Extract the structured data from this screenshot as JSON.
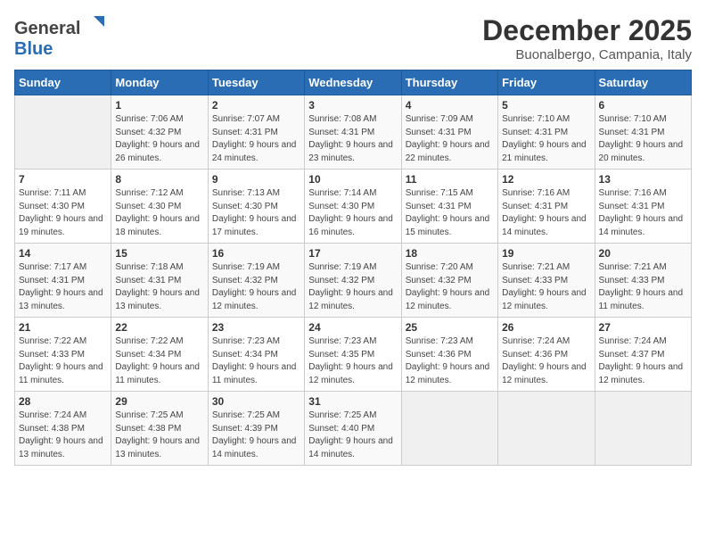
{
  "header": {
    "logo_general": "General",
    "logo_blue": "Blue",
    "month_title": "December 2025",
    "location": "Buonalbergo, Campania, Italy"
  },
  "days_of_week": [
    "Sunday",
    "Monday",
    "Tuesday",
    "Wednesday",
    "Thursday",
    "Friday",
    "Saturday"
  ],
  "weeks": [
    [
      {
        "day": "",
        "sunrise": "",
        "sunset": "",
        "daylight": ""
      },
      {
        "day": "1",
        "sunrise": "Sunrise: 7:06 AM",
        "sunset": "Sunset: 4:32 PM",
        "daylight": "Daylight: 9 hours and 26 minutes."
      },
      {
        "day": "2",
        "sunrise": "Sunrise: 7:07 AM",
        "sunset": "Sunset: 4:31 PM",
        "daylight": "Daylight: 9 hours and 24 minutes."
      },
      {
        "day": "3",
        "sunrise": "Sunrise: 7:08 AM",
        "sunset": "Sunset: 4:31 PM",
        "daylight": "Daylight: 9 hours and 23 minutes."
      },
      {
        "day": "4",
        "sunrise": "Sunrise: 7:09 AM",
        "sunset": "Sunset: 4:31 PM",
        "daylight": "Daylight: 9 hours and 22 minutes."
      },
      {
        "day": "5",
        "sunrise": "Sunrise: 7:10 AM",
        "sunset": "Sunset: 4:31 PM",
        "daylight": "Daylight: 9 hours and 21 minutes."
      },
      {
        "day": "6",
        "sunrise": "Sunrise: 7:10 AM",
        "sunset": "Sunset: 4:31 PM",
        "daylight": "Daylight: 9 hours and 20 minutes."
      }
    ],
    [
      {
        "day": "7",
        "sunrise": "Sunrise: 7:11 AM",
        "sunset": "Sunset: 4:30 PM",
        "daylight": "Daylight: 9 hours and 19 minutes."
      },
      {
        "day": "8",
        "sunrise": "Sunrise: 7:12 AM",
        "sunset": "Sunset: 4:30 PM",
        "daylight": "Daylight: 9 hours and 18 minutes."
      },
      {
        "day": "9",
        "sunrise": "Sunrise: 7:13 AM",
        "sunset": "Sunset: 4:30 PM",
        "daylight": "Daylight: 9 hours and 17 minutes."
      },
      {
        "day": "10",
        "sunrise": "Sunrise: 7:14 AM",
        "sunset": "Sunset: 4:30 PM",
        "daylight": "Daylight: 9 hours and 16 minutes."
      },
      {
        "day": "11",
        "sunrise": "Sunrise: 7:15 AM",
        "sunset": "Sunset: 4:31 PM",
        "daylight": "Daylight: 9 hours and 15 minutes."
      },
      {
        "day": "12",
        "sunrise": "Sunrise: 7:16 AM",
        "sunset": "Sunset: 4:31 PM",
        "daylight": "Daylight: 9 hours and 14 minutes."
      },
      {
        "day": "13",
        "sunrise": "Sunrise: 7:16 AM",
        "sunset": "Sunset: 4:31 PM",
        "daylight": "Daylight: 9 hours and 14 minutes."
      }
    ],
    [
      {
        "day": "14",
        "sunrise": "Sunrise: 7:17 AM",
        "sunset": "Sunset: 4:31 PM",
        "daylight": "Daylight: 9 hours and 13 minutes."
      },
      {
        "day": "15",
        "sunrise": "Sunrise: 7:18 AM",
        "sunset": "Sunset: 4:31 PM",
        "daylight": "Daylight: 9 hours and 13 minutes."
      },
      {
        "day": "16",
        "sunrise": "Sunrise: 7:19 AM",
        "sunset": "Sunset: 4:32 PM",
        "daylight": "Daylight: 9 hours and 12 minutes."
      },
      {
        "day": "17",
        "sunrise": "Sunrise: 7:19 AM",
        "sunset": "Sunset: 4:32 PM",
        "daylight": "Daylight: 9 hours and 12 minutes."
      },
      {
        "day": "18",
        "sunrise": "Sunrise: 7:20 AM",
        "sunset": "Sunset: 4:32 PM",
        "daylight": "Daylight: 9 hours and 12 minutes."
      },
      {
        "day": "19",
        "sunrise": "Sunrise: 7:21 AM",
        "sunset": "Sunset: 4:33 PM",
        "daylight": "Daylight: 9 hours and 12 minutes."
      },
      {
        "day": "20",
        "sunrise": "Sunrise: 7:21 AM",
        "sunset": "Sunset: 4:33 PM",
        "daylight": "Daylight: 9 hours and 11 minutes."
      }
    ],
    [
      {
        "day": "21",
        "sunrise": "Sunrise: 7:22 AM",
        "sunset": "Sunset: 4:33 PM",
        "daylight": "Daylight: 9 hours and 11 minutes."
      },
      {
        "day": "22",
        "sunrise": "Sunrise: 7:22 AM",
        "sunset": "Sunset: 4:34 PM",
        "daylight": "Daylight: 9 hours and 11 minutes."
      },
      {
        "day": "23",
        "sunrise": "Sunrise: 7:23 AM",
        "sunset": "Sunset: 4:34 PM",
        "daylight": "Daylight: 9 hours and 11 minutes."
      },
      {
        "day": "24",
        "sunrise": "Sunrise: 7:23 AM",
        "sunset": "Sunset: 4:35 PM",
        "daylight": "Daylight: 9 hours and 12 minutes."
      },
      {
        "day": "25",
        "sunrise": "Sunrise: 7:23 AM",
        "sunset": "Sunset: 4:36 PM",
        "daylight": "Daylight: 9 hours and 12 minutes."
      },
      {
        "day": "26",
        "sunrise": "Sunrise: 7:24 AM",
        "sunset": "Sunset: 4:36 PM",
        "daylight": "Daylight: 9 hours and 12 minutes."
      },
      {
        "day": "27",
        "sunrise": "Sunrise: 7:24 AM",
        "sunset": "Sunset: 4:37 PM",
        "daylight": "Daylight: 9 hours and 12 minutes."
      }
    ],
    [
      {
        "day": "28",
        "sunrise": "Sunrise: 7:24 AM",
        "sunset": "Sunset: 4:38 PM",
        "daylight": "Daylight: 9 hours and 13 minutes."
      },
      {
        "day": "29",
        "sunrise": "Sunrise: 7:25 AM",
        "sunset": "Sunset: 4:38 PM",
        "daylight": "Daylight: 9 hours and 13 minutes."
      },
      {
        "day": "30",
        "sunrise": "Sunrise: 7:25 AM",
        "sunset": "Sunset: 4:39 PM",
        "daylight": "Daylight: 9 hours and 14 minutes."
      },
      {
        "day": "31",
        "sunrise": "Sunrise: 7:25 AM",
        "sunset": "Sunset: 4:40 PM",
        "daylight": "Daylight: 9 hours and 14 minutes."
      },
      {
        "day": "",
        "sunrise": "",
        "sunset": "",
        "daylight": ""
      },
      {
        "day": "",
        "sunrise": "",
        "sunset": "",
        "daylight": ""
      },
      {
        "day": "",
        "sunrise": "",
        "sunset": "",
        "daylight": ""
      }
    ]
  ]
}
